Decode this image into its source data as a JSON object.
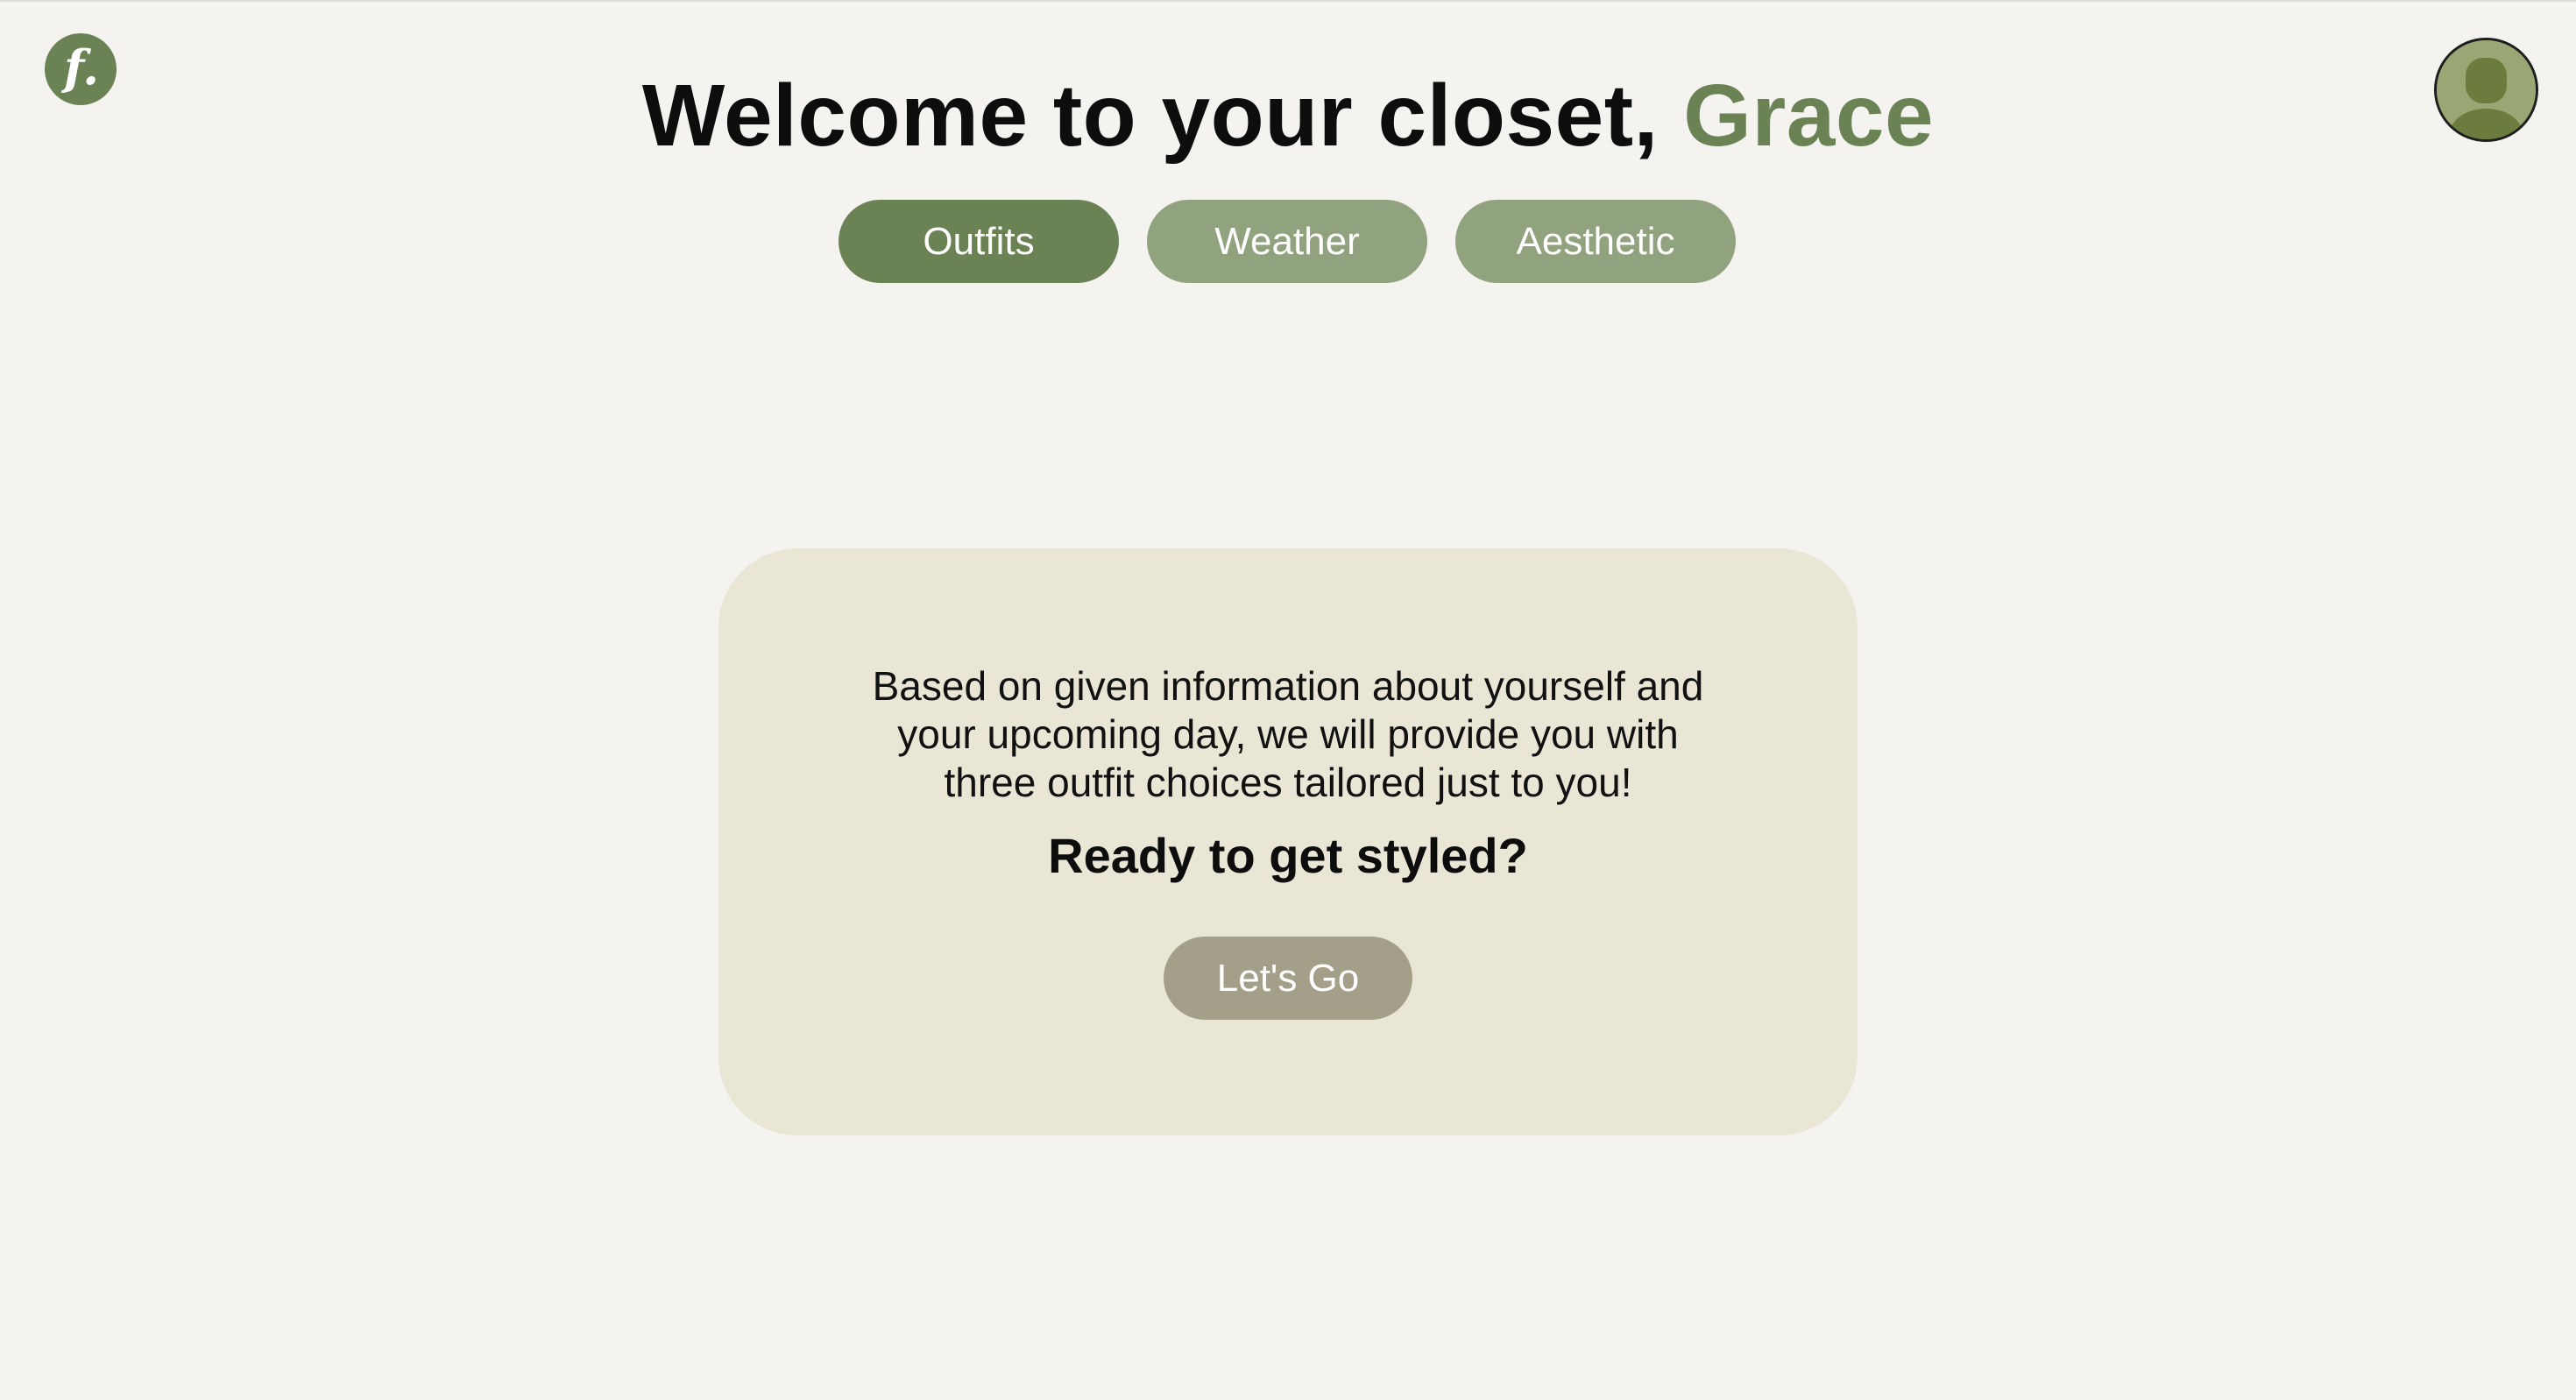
{
  "brand": {
    "logo_text": "f.",
    "icon": "brand-logo"
  },
  "header": {
    "title_prefix": "Welcome to your closet,",
    "user_name": "Grace"
  },
  "tabs": [
    {
      "label": "Outfits",
      "active": true
    },
    {
      "label": "Weather",
      "active": false
    },
    {
      "label": "Aesthetic",
      "active": false
    }
  ],
  "card": {
    "description_lines": [
      "Based on given information about yourself and",
      "your upcoming day, we will provide you with",
      "three outfit choices tailored just to you!"
    ],
    "question": "Ready to get styled?",
    "button_label": "Let's Go"
  },
  "avatar": {
    "icon": "user-avatar-icon"
  },
  "colors": {
    "background": "#f4f3ef",
    "accent": "#6a8254",
    "tab_inactive": "#91a27e",
    "card_background": "#e9e6d6",
    "button_muted": "#a49f88"
  }
}
